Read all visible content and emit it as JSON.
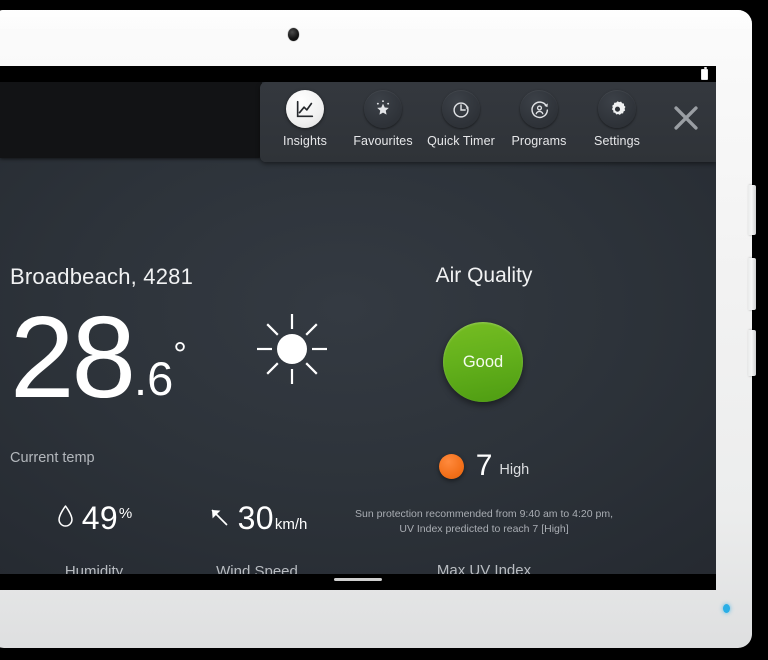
{
  "device": {
    "camera": "front-camera",
    "led": "status-led",
    "battery": "battery-icon"
  },
  "toolbar": {
    "items": [
      {
        "label": "Insights",
        "icon": "line-chart-icon",
        "active": true
      },
      {
        "label": "Favourites",
        "icon": "star-icon",
        "active": false
      },
      {
        "label": "Quick Timer",
        "icon": "timer-clock-icon",
        "active": false
      },
      {
        "label": "Programs",
        "icon": "programs-icon",
        "active": false
      },
      {
        "label": "Settings",
        "icon": "gear-icon",
        "active": false
      }
    ],
    "close_label": "✕"
  },
  "weather": {
    "location": "Broadbeach, 4281",
    "temp_integer": "28",
    "temp_decimal": ".6",
    "temp_degree": "°",
    "current_temp_label": "Current temp",
    "condition_icon": "sun-icon",
    "humidity": {
      "value": "49",
      "unit": "%",
      "caption": "Humidity",
      "icon": "water-drop-icon"
    },
    "wind": {
      "value": "30",
      "unit": "km/h",
      "caption": "Wind Speed",
      "icon": "wind-direction-arrow-icon"
    }
  },
  "air_quality": {
    "title": "Air Quality",
    "status": "Good",
    "status_color": "#64b11c",
    "uv_value": "7",
    "uv_level": "High",
    "uv_dot_color": "#f3701a",
    "note": "Sun protection recommended from  9:40 am to 4:20 pm, UV Index predicted to reach 7 [High]",
    "caption": "Max UV Index"
  }
}
